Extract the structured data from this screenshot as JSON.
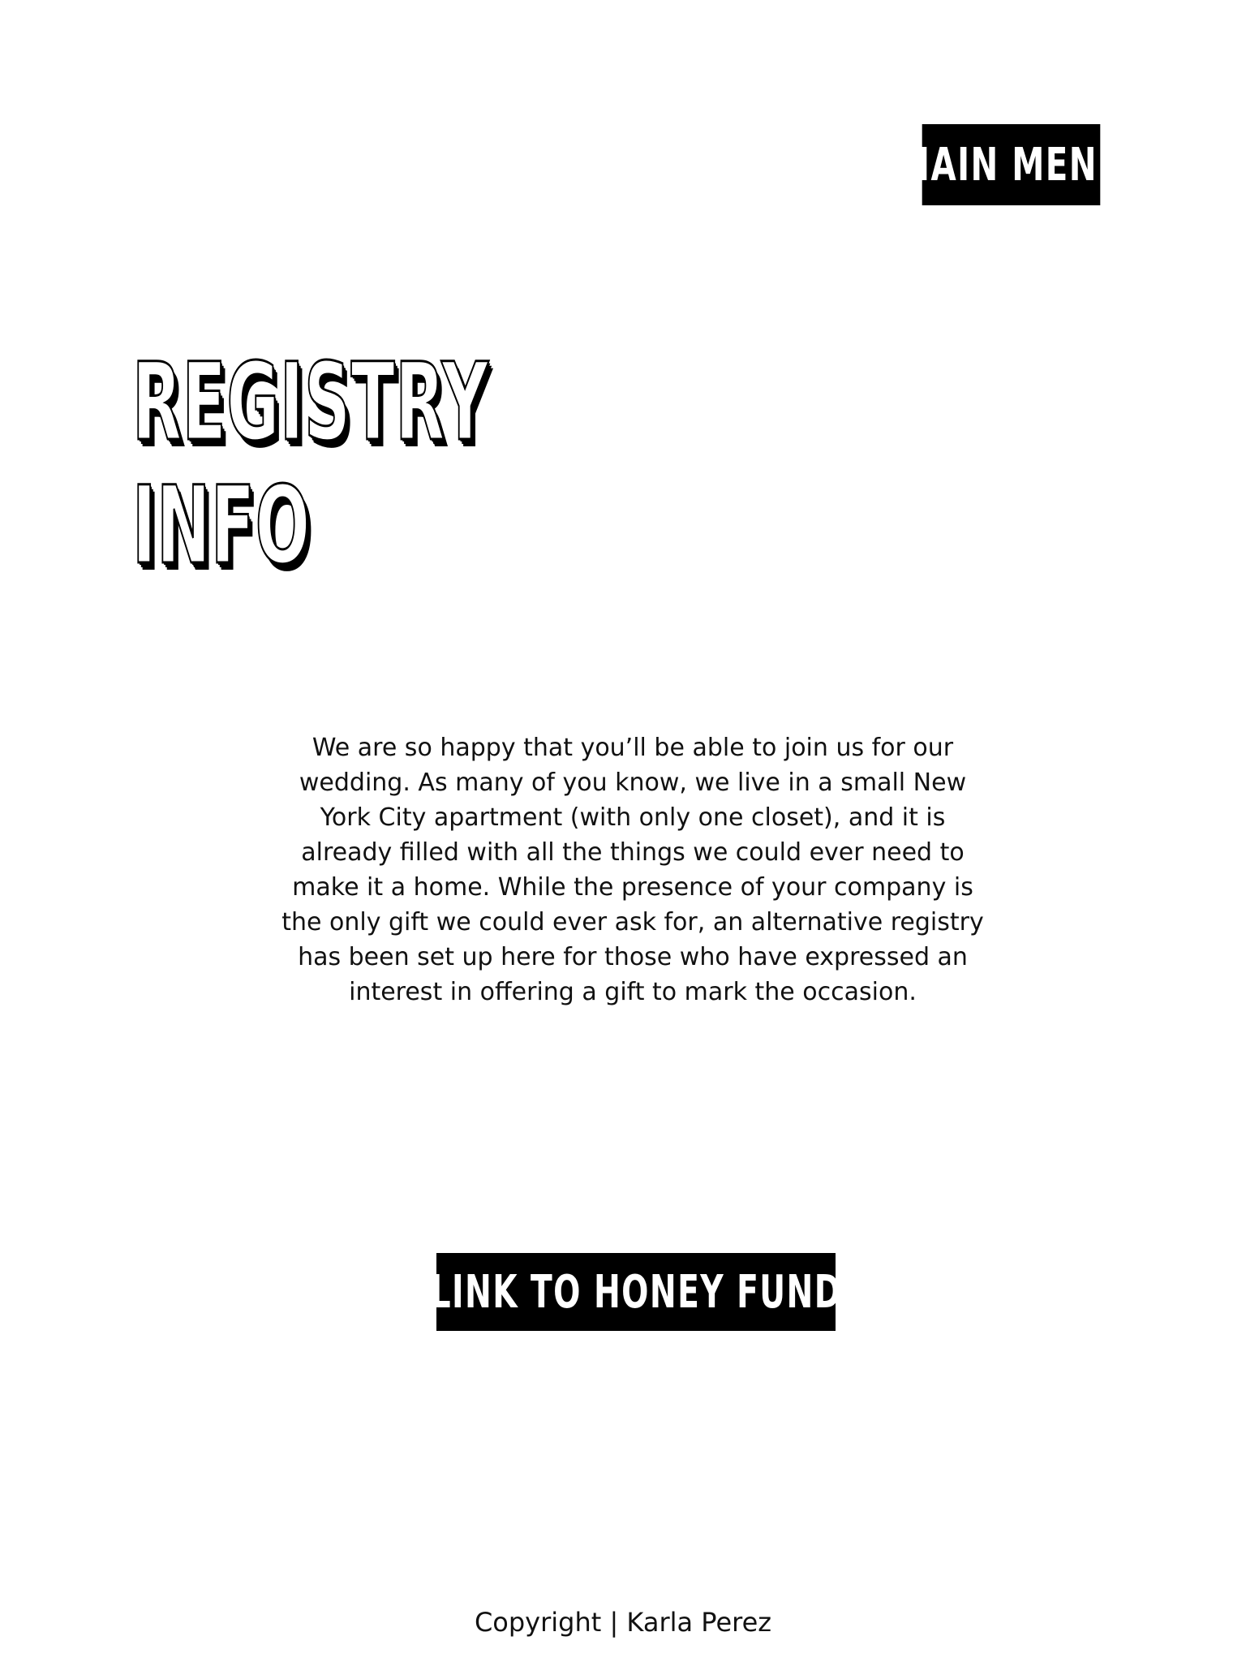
{
  "header": {
    "main_menu_label": "MAIN MENU"
  },
  "page": {
    "title_line1": "REGISTRY",
    "title_line2": "INFO",
    "body": "We are so happy that you’ll be able to join us for our wedding. As many of you know, we live in a small New York City apartment (with only one closet), and it is already filled with all the things we could ever need to make it a home. While the presence of your company is the only gift we could ever ask for, an alternative registry has been set up here for those who have expressed an interest in offering a gift to mark the occasion."
  },
  "actions": {
    "honey_fund_label": "LINK TO HONEY FUND"
  },
  "footer": {
    "copyright": "Copyright | Karla Perez"
  },
  "colors": {
    "background": "#ffffff",
    "button_bg": "#000000",
    "button_text": "#ffffff"
  }
}
